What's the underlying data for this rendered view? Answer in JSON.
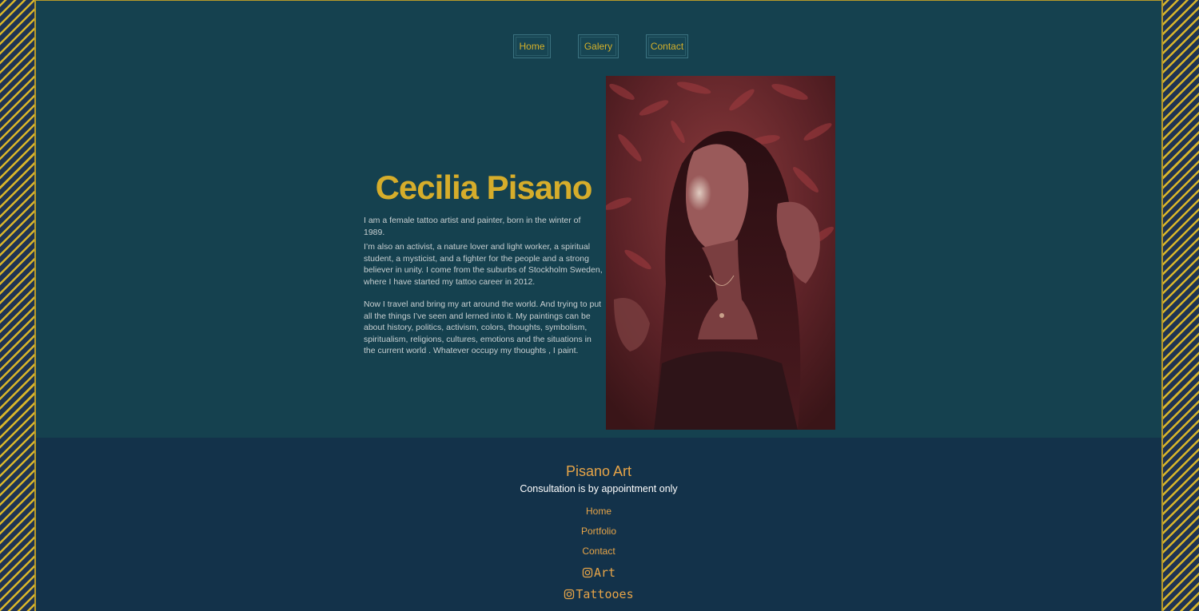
{
  "nav": {
    "items": [
      {
        "label": "Home"
      },
      {
        "label": "Galery"
      },
      {
        "label": "Contact"
      }
    ]
  },
  "intro": {
    "name": "Cecilia Pisano",
    "bio": [
      "I am a female tattoo artist and painter, born in the winter of 1989.",
      "I’m also an activist, a nature lover and light worker, a spiritual student, a mysticist, and a fighter for the people and a strong believer in unity. I come from the suburbs of Stockholm Sweden, where I have started my tattoo career in 2012.",
      "Now I travel and bring my art around the world. And trying to put all the things I’ve seen and lerned into it. My paintings can be about history, politics, activism, colors, thoughts, symbolism, spiritualism, religions, cultures, emotions and the situations in the current world . Whatever occupy my thoughts , I paint."
    ]
  },
  "photo": {
    "icon": "portrait-photo"
  },
  "footer": {
    "brand": "Pisano Art",
    "note": "Consultation is by appointment only",
    "links": [
      {
        "label": "Home"
      },
      {
        "label": "Portfolio"
      },
      {
        "label": "Contact"
      }
    ],
    "social": [
      {
        "label": "Art",
        "icon": "instagram-icon"
      },
      {
        "label": "Tattooes",
        "icon": "instagram-icon"
      }
    ]
  },
  "colors": {
    "page_bg": "#15414f",
    "footer_bg": "#13324a",
    "accent_gold": "#d6ad2b",
    "accent_orange": "#e6a448",
    "stripe_dark": "#1f3352",
    "stripe_gold": "#d9b62b"
  }
}
